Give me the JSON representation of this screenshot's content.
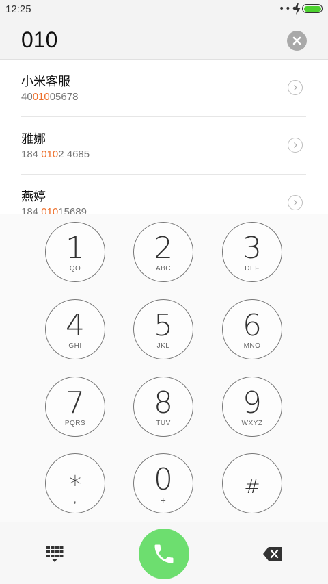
{
  "status_bar": {
    "time": "12:25",
    "dots": "•••",
    "battery_color": "#4cd12e"
  },
  "dial_input": {
    "number": "010",
    "clear_icon": "clear-icon"
  },
  "contacts": [
    {
      "name": "小米客服",
      "phone_pre": "40",
      "phone_match": "010",
      "phone_post": "05678"
    },
    {
      "name": "雅娜",
      "phone_pre": "184 ",
      "phone_match": "010",
      "phone_post": "2 4685"
    },
    {
      "name": "燕婷",
      "phone_pre": "184 ",
      "phone_match": "010",
      "phone_post": "15689"
    }
  ],
  "highlight_color": "#ee6f2a",
  "keypad": {
    "keys": [
      {
        "digit": "1",
        "letters": "QO"
      },
      {
        "digit": "2",
        "letters": "ABC"
      },
      {
        "digit": "3",
        "letters": "DEF"
      },
      {
        "digit": "4",
        "letters": "GHI"
      },
      {
        "digit": "5",
        "letters": "JKL"
      },
      {
        "digit": "6",
        "letters": "MNO"
      },
      {
        "digit": "7",
        "letters": "PQRS"
      },
      {
        "digit": "8",
        "letters": "TUV"
      },
      {
        "digit": "9",
        "letters": "WXYZ"
      },
      {
        "digit": "*",
        "letters": ","
      },
      {
        "digit": "0",
        "letters": "+"
      },
      {
        "digit": "#",
        "letters": ""
      }
    ]
  },
  "bottom_bar": {
    "keypad_toggle_icon": "dialpad-icon",
    "call_icon": "phone-icon",
    "call_color": "#6dde6f",
    "backspace_icon": "backspace-icon"
  }
}
